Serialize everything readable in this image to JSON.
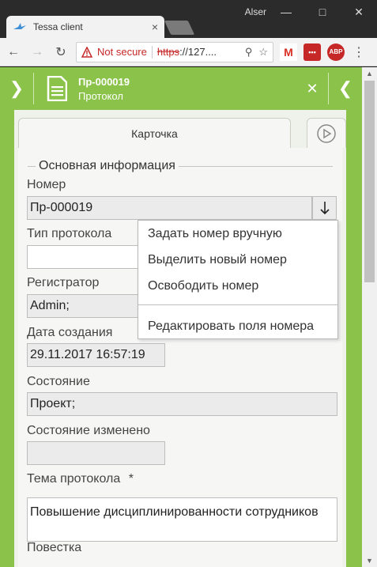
{
  "browser": {
    "tab_title": "Tessa client",
    "tab_close": "×",
    "window_user": "Alser",
    "not_secure": "Not secure",
    "url_scheme": "https",
    "url_rest": "://127...."
  },
  "app_header": {
    "card_number": "Пр-000019",
    "card_type": "Протокол",
    "accent_color": "#8bc34a"
  },
  "tabs": {
    "card_tab_label": "Карточка"
  },
  "form": {
    "section_title": "Основная информация",
    "number_label": "Номер",
    "number_value": "Пр-000019",
    "protocol_type_label": "Тип протокола",
    "protocol_type_value": "",
    "registrar_label": "Регистратор",
    "registrar_value": "Admin;",
    "created_label": "Дата создания",
    "created_value": "29.11.2017 16:57:19",
    "state_label": "Состояние",
    "state_value": "Проект;",
    "state_changed_label": "Состояние изменено",
    "state_changed_value": "",
    "topic_label": "Тема протокола",
    "required_mark": "*",
    "topic_value": "Повышение дисциплинированности сотрудников",
    "agenda_label": "Повестка"
  },
  "number_menu": {
    "items": [
      "Задать номер вручную",
      "Выделить новый номер",
      "Освободить номер",
      "Редактировать поля номера"
    ]
  }
}
